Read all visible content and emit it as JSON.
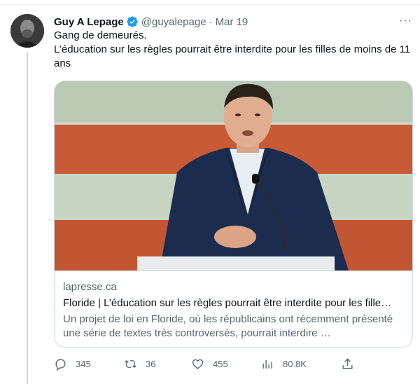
{
  "tweet": {
    "author": {
      "display_name": "Guy A Lepage",
      "handle": "@guyalepage",
      "verified": true,
      "verified_color": "#1d9bf0"
    },
    "separator": "·",
    "date": "Mar 19",
    "more_icon": "···",
    "text_lines": [
      "Gang de demeurés.",
      "L’éducation sur les règles pourrait être interdite pour les filles de moins de 11 ans"
    ]
  },
  "card": {
    "domain": "lapresse.ca",
    "title": "Floride | L’éducation sur les règles pourrait être interdite pour les fille…",
    "description": "Un projet de loi en Floride, où les républicains ont récemment présenté une série de textes très controversés, pourrait interdire …"
  },
  "actions": {
    "replies": "345",
    "retweets": "36",
    "likes": "455",
    "views": "80.8K"
  },
  "icons": {
    "reply": "reply-icon",
    "retweet": "retweet-icon",
    "like": "heart-icon",
    "views": "views-chart-icon",
    "share": "share-icon",
    "verified": "verified-badge-icon",
    "more": "more-options-icon"
  },
  "colors": {
    "text_primary": "#0f1419",
    "text_secondary": "#536471",
    "border": "#cfd9de",
    "accent": "#1d9bf0"
  }
}
